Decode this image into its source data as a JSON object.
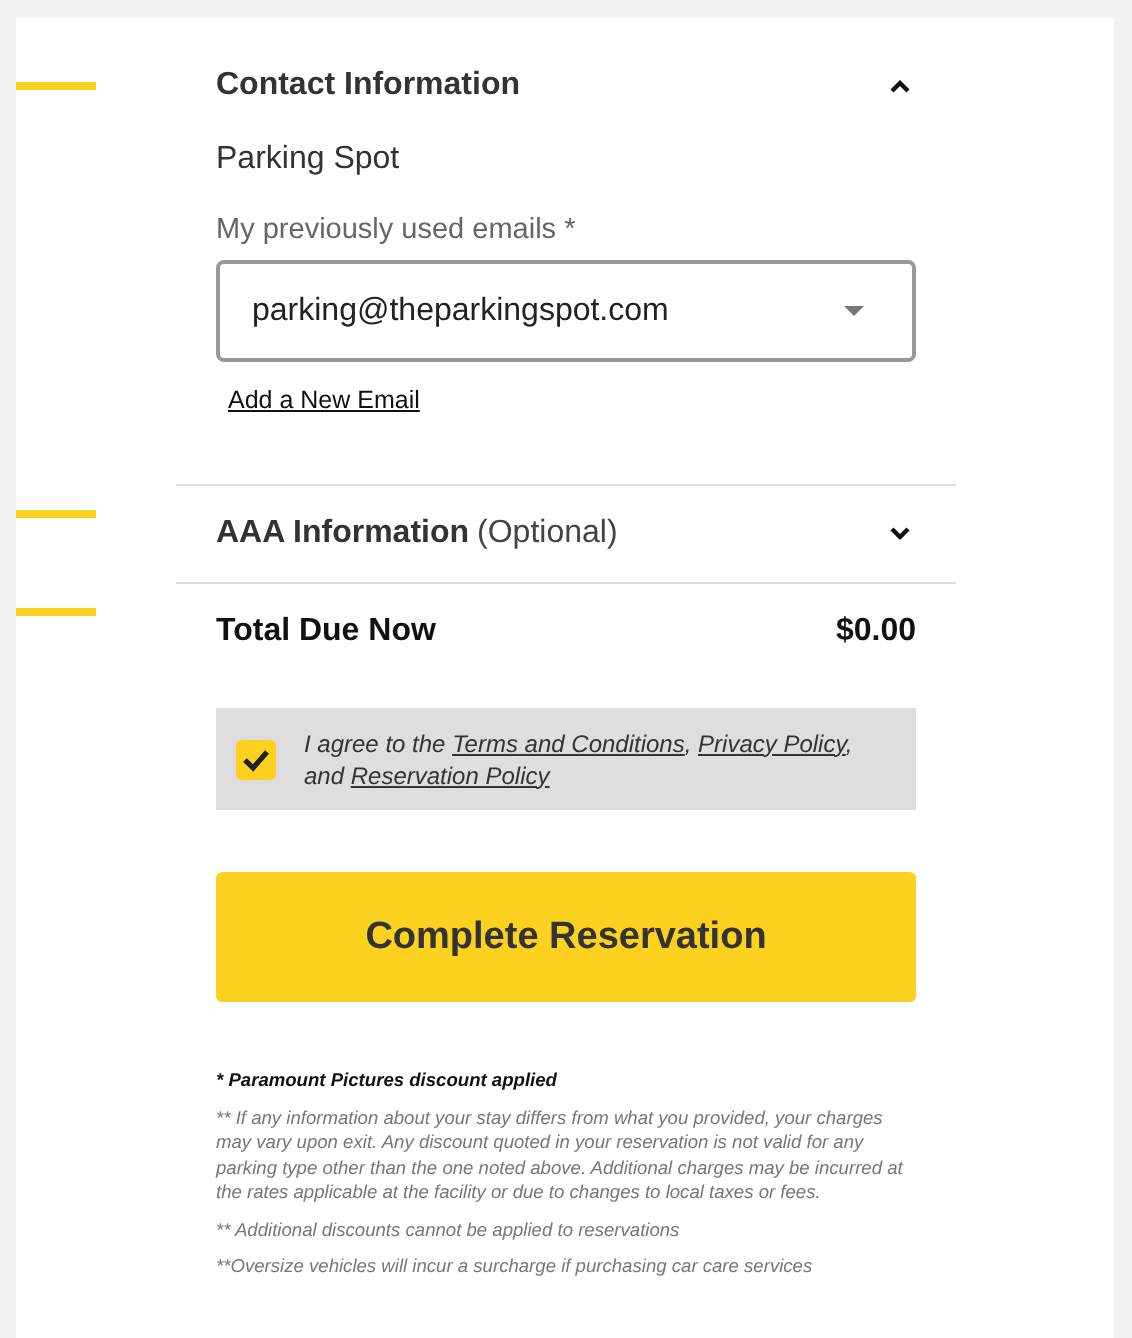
{
  "sections": [
    {
      "title": "Contact Information",
      "expanded": true,
      "company": "Parking Spot",
      "email_label": "My previously used emails *",
      "email_value": "parking@theparkingspot.com",
      "add_link": "Add a New Email"
    },
    {
      "title": "AAA Information",
      "optional": "(Optional)",
      "expanded": false
    }
  ],
  "total": {
    "label": "Total Due Now",
    "amount": "$0.00"
  },
  "agreement": {
    "checked": true,
    "parts": [
      {
        "kind": "text",
        "text": "I agree to the "
      },
      {
        "kind": "link",
        "text": "Terms and Conditions"
      },
      {
        "kind": "text",
        "text": ", "
      },
      {
        "kind": "link",
        "text": "Privacy Policy"
      },
      {
        "kind": "text",
        "text": ", and "
      },
      {
        "kind": "link",
        "text": "Reservation Policy"
      }
    ]
  },
  "submit": "Complete Reservation",
  "notes": [
    {
      "kind": "highlight",
      "text": "* Paramount Pictures discount applied"
    },
    {
      "kind": "plain",
      "text": "** If any information about your stay differs from what you provided, your charges may vary upon exit. Any discount quoted in your reservation is not valid for any parking type other than the one noted above. Additional charges may be incurred at the rates applicable at the facility or due to changes to local taxes or fees."
    },
    {
      "kind": "plain",
      "text": "** Additional discounts cannot be applied to reservations"
    },
    {
      "kind": "plain",
      "text": "**Oversize vehicles will incur a surcharge if purchasing car care services"
    }
  ]
}
